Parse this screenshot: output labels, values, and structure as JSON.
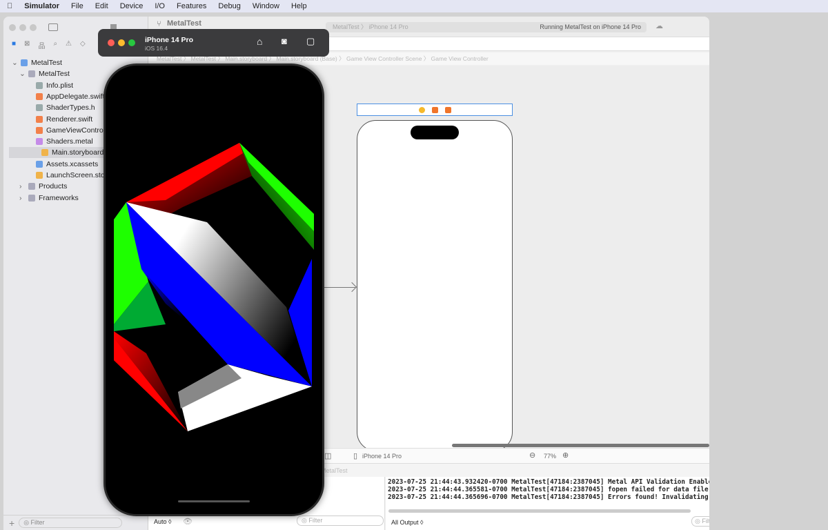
{
  "menubar": {
    "app": "Simulator",
    "items": [
      "File",
      "Edit",
      "Device",
      "I/O",
      "Features",
      "Debug",
      "Window",
      "Help"
    ]
  },
  "xcode": {
    "project_title": "MetalTest",
    "scheme": "MetalTest",
    "destination": "iPhone 14 Pro",
    "status": "Running MetalTest on iPhone 14 Pro",
    "breadcrumb": [
      "MetalTest",
      "MetalTest",
      "Main.storyboard",
      "Main.storyboard (Base)",
      "Game View Controller Scene",
      "Game View Controller"
    ],
    "tree": [
      {
        "label": "MetalTest",
        "level": 0,
        "expanded": true
      },
      {
        "label": "MetalTest",
        "level": 1,
        "expanded": true
      },
      {
        "label": "Info.plist",
        "level": 2
      },
      {
        "label": "AppDelegate.swift",
        "level": 2
      },
      {
        "label": "ShaderTypes.h",
        "level": 2
      },
      {
        "label": "Renderer.swift",
        "level": 2
      },
      {
        "label": "GameViewController.swift",
        "level": 2
      },
      {
        "label": "Shaders.metal",
        "level": 2
      },
      {
        "label": "Main.storyboard",
        "level": 2,
        "selected": true
      },
      {
        "label": "Assets.xcassets",
        "level": 2
      },
      {
        "label": "LaunchScreen.storyboard",
        "level": 2
      },
      {
        "label": "Products",
        "level": 1,
        "expanded": false
      },
      {
        "label": "Frameworks",
        "level": 1,
        "expanded": false
      }
    ],
    "filter_placeholder": "Filter",
    "canvas_device": "iPhone 14 Pro",
    "zoom": "77%",
    "debug_breadcrumb": "MetalTest",
    "auto_label": "Auto ◊",
    "output_select": "All Output ◊",
    "console": [
      "2023-07-25 21:44:43.932420-0700 MetalTest[47184:2387045] Metal API Validation Enabled",
      "2023-07-25 21:44:44.365581-0700 MetalTest[47184:2387045] fopen failed for data file: ",
      "2023-07-25 21:44:44.365696-0700 MetalTest[47184:2387045] Errors found! Invalidating c"
    ]
  },
  "simulator": {
    "device": "iPhone 14 Pro",
    "os": "iOS 16.4",
    "icons": [
      "home-icon",
      "screenshot-icon",
      "rotate-icon"
    ]
  },
  "colors": {
    "red": "#ff0000",
    "green": "#1eff00",
    "blue": "#0000ff",
    "accent": "#2a7ae2"
  }
}
